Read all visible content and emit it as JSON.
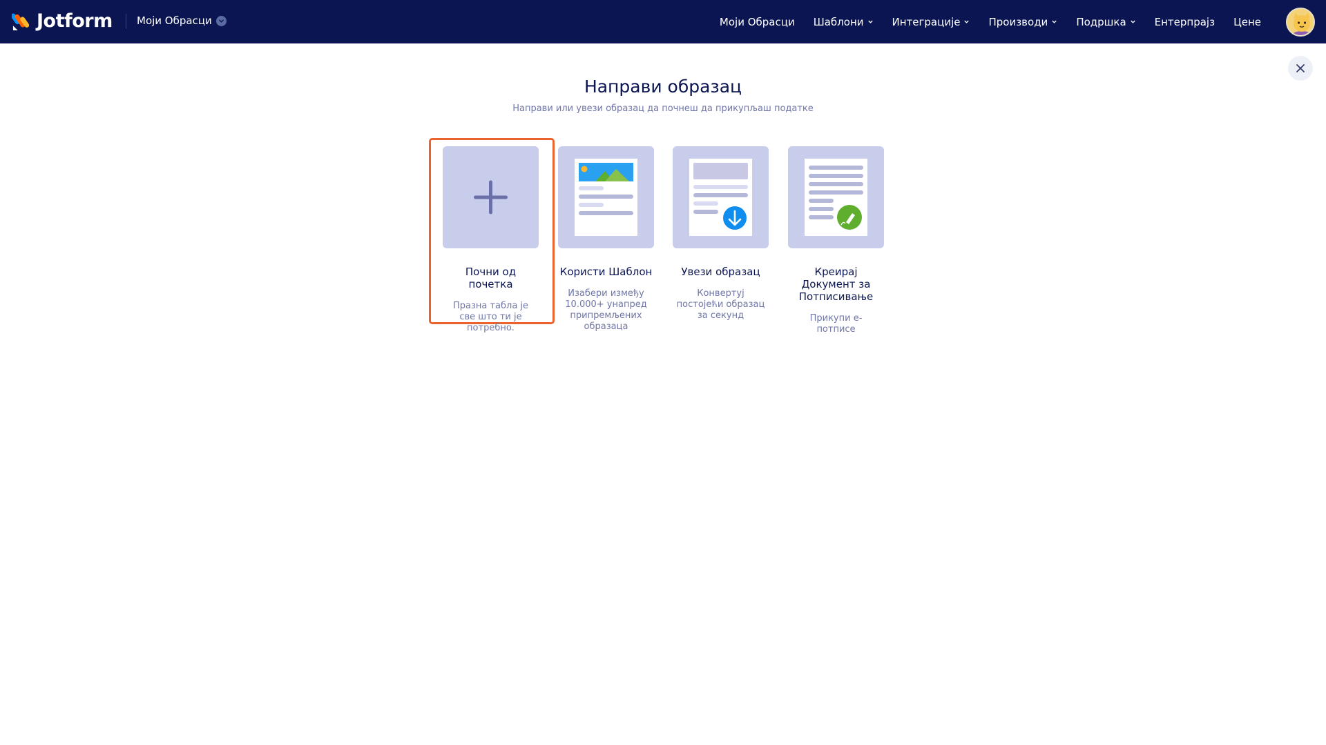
{
  "topbar": {
    "logo_text": "Jotform",
    "myforms_dropdown": "Моји Обрасци",
    "nav": [
      {
        "label": "Моји Обрасци",
        "has_caret": false
      },
      {
        "label": "Шаблони",
        "has_caret": true
      },
      {
        "label": "Интеграције",
        "has_caret": true
      },
      {
        "label": "Производи",
        "has_caret": true
      },
      {
        "label": "Подршка",
        "has_caret": true
      },
      {
        "label": "Ентерпрајз",
        "has_caret": false
      },
      {
        "label": "Цене",
        "has_caret": false
      }
    ]
  },
  "page": {
    "title": "Направи образац",
    "subtitle": "Направи или увези образац да почнеш да прикупљаш податке"
  },
  "cards": [
    {
      "title": "Почни од почетка",
      "desc": "Празна табла је све што ти је потребно.",
      "icon": "plus-icon",
      "selected": true
    },
    {
      "title": "Користи Шаблон",
      "desc": "Изабери између 10.000+ унапред припремљених образаца",
      "icon": "template-icon",
      "selected": false
    },
    {
      "title": "Увези образац",
      "desc": "Конвертуј постојећи образац за секунд",
      "icon": "import-icon",
      "selected": false
    },
    {
      "title": "Креирај Документ за Потписивање",
      "desc": "Прикупи е-потписе",
      "icon": "sign-document-icon",
      "selected": false
    }
  ],
  "colors": {
    "nav_bg": "#0a1551",
    "card_bg": "#c8cdec",
    "selection": "#e9632e",
    "title": "#0a1551",
    "muted": "#6f76a7"
  }
}
